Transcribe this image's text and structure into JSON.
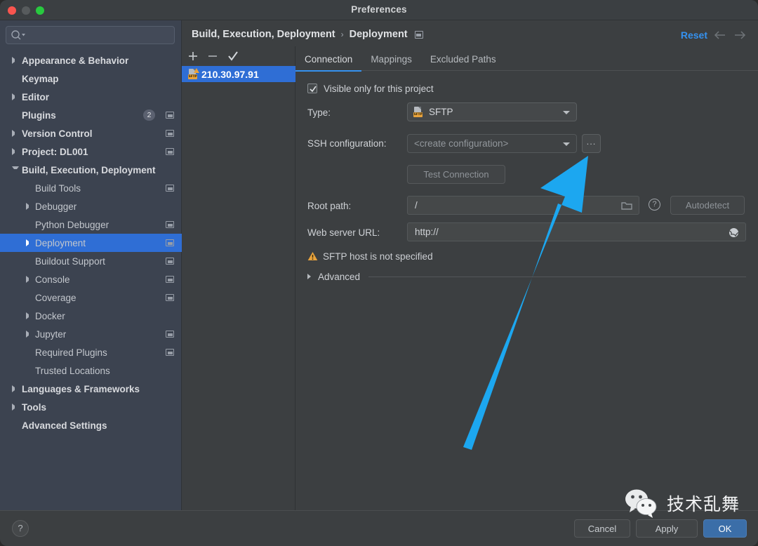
{
  "window": {
    "title": "Preferences",
    "traffic_lights": [
      "close-red",
      "minimize-gray",
      "zoom-green"
    ]
  },
  "sidebar": {
    "search": {
      "value": "",
      "placeholder": ""
    },
    "items": [
      {
        "label": "Appearance & Behavior",
        "level": 0,
        "arrow": "right",
        "bold": true
      },
      {
        "label": "Keymap",
        "level": 0,
        "arrow": "none",
        "bold": true
      },
      {
        "label": "Editor",
        "level": 0,
        "arrow": "right",
        "bold": true
      },
      {
        "label": "Plugins",
        "level": 0,
        "arrow": "none",
        "bold": true,
        "badge": "2",
        "window_icon": true
      },
      {
        "label": "Version Control",
        "level": 0,
        "arrow": "right",
        "bold": true,
        "window_icon": true
      },
      {
        "label": "Project: DL001",
        "level": 0,
        "arrow": "right",
        "bold": true,
        "window_icon": true
      },
      {
        "label": "Build, Execution, Deployment",
        "level": 0,
        "arrow": "down",
        "bold": true
      },
      {
        "label": "Build Tools",
        "level": 1,
        "arrow": "none",
        "window_icon": true
      },
      {
        "label": "Debugger",
        "level": 1,
        "arrow": "right"
      },
      {
        "label": "Python Debugger",
        "level": 1,
        "arrow": "none",
        "window_icon": true
      },
      {
        "label": "Deployment",
        "level": 1,
        "arrow": "right",
        "selected": true,
        "window_icon": true
      },
      {
        "label": "Buildout Support",
        "level": 1,
        "arrow": "none",
        "window_icon": true
      },
      {
        "label": "Console",
        "level": 1,
        "arrow": "right",
        "window_icon": true
      },
      {
        "label": "Coverage",
        "level": 1,
        "arrow": "none",
        "window_icon": true
      },
      {
        "label": "Docker",
        "level": 1,
        "arrow": "right"
      },
      {
        "label": "Jupyter",
        "level": 1,
        "arrow": "right",
        "window_icon": true
      },
      {
        "label": "Required Plugins",
        "level": 1,
        "arrow": "none",
        "window_icon": true
      },
      {
        "label": "Trusted Locations",
        "level": 1,
        "arrow": "none"
      },
      {
        "label": "Languages & Frameworks",
        "level": 0,
        "arrow": "right",
        "bold": true
      },
      {
        "label": "Tools",
        "level": 0,
        "arrow": "right",
        "bold": true
      },
      {
        "label": "Advanced Settings",
        "level": 0,
        "arrow": "none",
        "bold": true
      }
    ]
  },
  "header": {
    "breadcrumb_root": "Build, Execution, Deployment",
    "breadcrumb_sep": "›",
    "breadcrumb_leaf": "Deployment",
    "reset_label": "Reset",
    "nav_back_icon": "arrow-left-icon",
    "nav_forward_icon": "arrow-right-icon"
  },
  "server_panel": {
    "toolbar": {
      "add_icon": "plus-icon",
      "remove_icon": "minus-icon",
      "default_icon": "check-icon"
    },
    "servers": [
      {
        "name": "210.30.97.91",
        "type_icon": "sftp-warning-icon",
        "selected": true
      }
    ]
  },
  "tabs": [
    {
      "label": "Connection",
      "active": true
    },
    {
      "label": "Mappings",
      "active": false
    },
    {
      "label": "Excluded Paths",
      "active": false
    }
  ],
  "form": {
    "visible_only_checkbox": {
      "label": "Visible only for this project",
      "checked": true
    },
    "type": {
      "label": "Type:",
      "value": "SFTP",
      "icon": "sftp-icon"
    },
    "ssh_configuration": {
      "label": "SSH configuration:",
      "value": "<create configuration>",
      "ellipsis_button": "...",
      "ellipsis_name": "browse-button"
    },
    "test_connection": {
      "label": "Test Connection",
      "enabled": false
    },
    "root_path": {
      "label": "Root path:",
      "value": "/",
      "folder_icon": "folder-icon",
      "help_icon": "question-mark-icon",
      "autodetect_label": "Autodetect"
    },
    "web_server_url": {
      "label": "Web server URL:",
      "value": "http://",
      "globe_icon": "globe-icon"
    },
    "warning": {
      "icon": "warning-triangle-icon",
      "text": "SFTP host is not specified"
    },
    "advanced": {
      "label": "Advanced",
      "expanded": false
    }
  },
  "bottom_bar": {
    "help_label": "?",
    "cancel_label": "Cancel",
    "apply_label": "Apply",
    "ok_label": "OK"
  },
  "watermark": {
    "text": "技术乱舞",
    "logo_icon": "wechat-logo-icon"
  },
  "annotation": {
    "arrow_icon": "pointer-arrow-annotation",
    "color": "#1CA7F0",
    "points_to": "browse-button"
  },
  "colors": {
    "accent_blue": "#3592f0",
    "selection_blue": "#2f6ed5",
    "panel_bg": "#3c3f41",
    "sidebar_bg": "#3c4350",
    "warning_orange": "#e8a33d",
    "ok_button_blue": "#3b6ea8",
    "annotation_blue": "#1CA7F0"
  }
}
